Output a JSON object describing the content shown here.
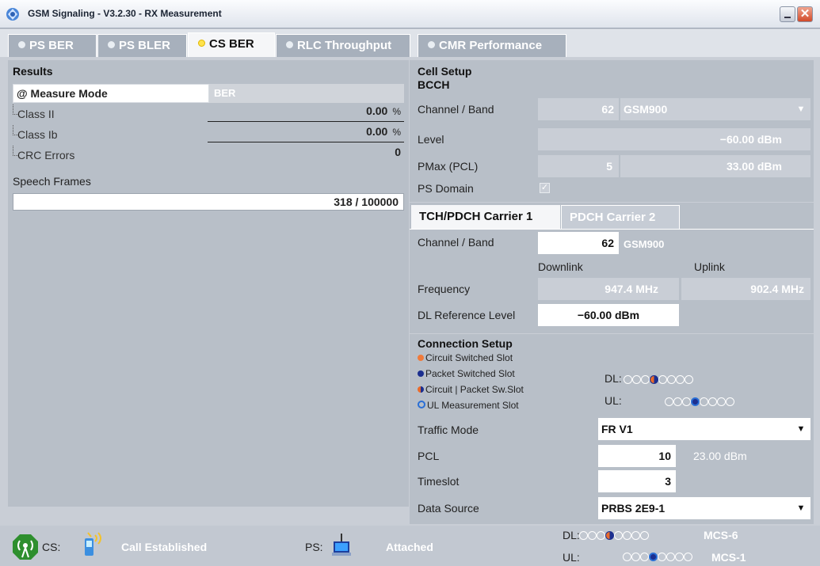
{
  "window": {
    "title": "GSM Signaling  - V3.2.30 - RX Measurement"
  },
  "tabs": [
    {
      "label": "PS BER",
      "active": false
    },
    {
      "label": "PS BLER",
      "active": false
    },
    {
      "label": "CS BER",
      "active": true
    },
    {
      "label": "RLC Throughput",
      "active": false
    },
    {
      "label": "CMR Performance",
      "active": false
    }
  ],
  "results": {
    "title": "Results",
    "measure_mode_label": "@ Measure Mode",
    "measure_mode_value": "BER",
    "rows": [
      {
        "label": "Class II",
        "value": "0.00",
        "unit": "%"
      },
      {
        "label": "Class Ib",
        "value": "0.00",
        "unit": "%"
      },
      {
        "label": "CRC Errors",
        "value": "0",
        "unit": ""
      }
    ],
    "speech_frames_label": "Speech Frames",
    "speech_frames_value": "318 / 100000"
  },
  "cell_setup": {
    "title": "Cell Setup",
    "subtitle": "BCCH",
    "channel_band_label": "Channel / Band",
    "channel_value": "62",
    "band_value": "GSM900",
    "level_label": "Level",
    "level_value": "−60.00  dBm",
    "pmax_label": "PMax (PCL)",
    "pmax_pcl": "5",
    "pmax_value": "33.00  dBm",
    "ps_domain_label": "PS Domain",
    "ps_domain_checked": true
  },
  "carrier": {
    "tabs": [
      {
        "label": "TCH/PDCH Carrier 1",
        "active": true
      },
      {
        "label": "PDCH Carrier 2",
        "active": false
      }
    ],
    "channel_band_label": "Channel / Band",
    "channel_value": "62",
    "band_value": "GSM900",
    "downlink_label": "Downlink",
    "uplink_label": "Uplink",
    "frequency_label": "Frequency",
    "freq_dl": "947.4  MHz",
    "freq_ul": "902.4  MHz",
    "dl_ref_label": "DL Reference Level",
    "dl_ref_value": "−60.00  dBm"
  },
  "connection": {
    "title": "Connection Setup",
    "legend": [
      {
        "label": "Circuit Switched Slot",
        "color": "#f07a3a"
      },
      {
        "label": "Packet Switched Slot",
        "color": "#1c2f8f"
      },
      {
        "label": "Circuit | Packet Sw.Slot",
        "color": "#1c2f8f"
      },
      {
        "label": "UL Measurement Slot",
        "color": "#2a6fd6"
      }
    ],
    "dl_label": "DL:",
    "ul_label": "UL:",
    "dl_active_slot": 3,
    "ul_active_slot": 3,
    "traffic_mode_label": "Traffic Mode",
    "traffic_mode_value": "FR V1",
    "pcl_label": "PCL",
    "pcl_value": "10",
    "pcl_dbm": "23.00 dBm",
    "timeslot_label": "Timeslot",
    "timeslot_value": "3",
    "data_source_label": "Data Source",
    "data_source_value": "PRBS 2E9-1"
  },
  "status": {
    "cs_label": "CS:",
    "cs_status": "Call Established",
    "ps_label": "PS:",
    "ps_status": "Attached",
    "dl_label": "DL:",
    "ul_label": "UL:",
    "dl_mcs": "MCS-6",
    "ul_mcs": "MCS-1"
  }
}
